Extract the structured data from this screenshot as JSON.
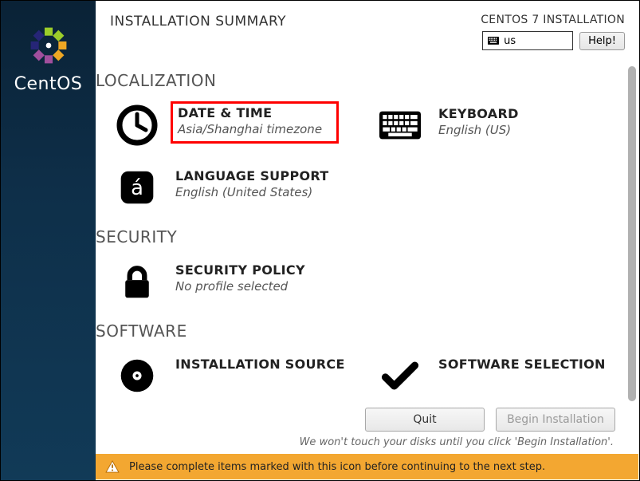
{
  "sidebar": {
    "brand": "CentOS"
  },
  "header": {
    "title": "INSTALLATION SUMMARY",
    "subtitle": "CENTOS 7 INSTALLATION",
    "kb_layout": "us",
    "help_label": "Help!"
  },
  "categories": [
    {
      "heading": "LOCALIZATION",
      "rows": [
        [
          {
            "id": "datetime",
            "title": "DATE & TIME",
            "sub": "Asia/Shanghai timezone",
            "highlighted": true
          },
          {
            "id": "keyboard",
            "title": "KEYBOARD",
            "sub": "English (US)"
          }
        ],
        [
          {
            "id": "langsupport",
            "title": "LANGUAGE SUPPORT",
            "sub": "English (United States)"
          }
        ]
      ]
    },
    {
      "heading": "SECURITY",
      "rows": [
        [
          {
            "id": "secpolicy",
            "title": "SECURITY POLICY",
            "sub": "No profile selected"
          }
        ]
      ]
    },
    {
      "heading": "SOFTWARE",
      "rows": [
        [
          {
            "id": "installsource",
            "title": "INSTALLATION SOURCE",
            "sub": ""
          },
          {
            "id": "softsel",
            "title": "SOFTWARE SELECTION",
            "sub": ""
          }
        ]
      ]
    }
  ],
  "footer": {
    "quit_label": "Quit",
    "begin_label": "Begin Installation",
    "note": "We won't touch your disks until you click 'Begin Installation'."
  },
  "warning": {
    "text": "Please complete items marked with this icon before continuing to the next step."
  }
}
